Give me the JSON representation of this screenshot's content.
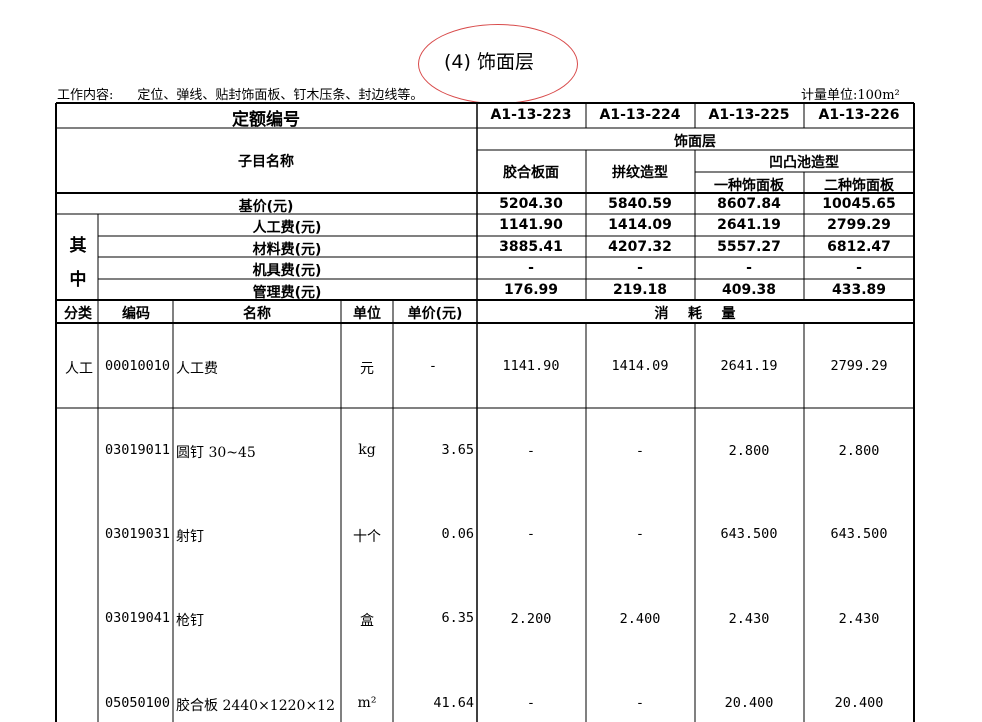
{
  "title": "(4) 饰面层",
  "work_content": {
    "label": "工作内容:",
    "text": "定位、弹线、贴封饰面板、钉木压条、封边线等。"
  },
  "measure_unit": "计量单位:100m²",
  "header": {
    "quota_label": "定额编号",
    "codes": [
      "A1-13-223",
      "A1-13-224",
      "A1-13-225",
      "A1-13-226"
    ],
    "subitem_label": "子目名称",
    "group": "饰面层",
    "col1": "胶合板面",
    "col2": "拼纹造型",
    "group2": "凹凸池造型",
    "col3": "一种饰面板",
    "col4": "二种饰面板"
  },
  "costs": {
    "base_label": "基价(元)",
    "base": [
      "5204.30",
      "5840.59",
      "8607.84",
      "10045.65"
    ],
    "among_1": "其",
    "among_2": "中",
    "labor_label": "人工费(元)",
    "labor": [
      "1141.90",
      "1414.09",
      "2641.19",
      "2799.29"
    ],
    "material_label": "材料费(元)",
    "material": [
      "3885.41",
      "4207.32",
      "5557.27",
      "6812.47"
    ],
    "machine_label": "机具费(元)",
    "machine": [
      "-",
      "-",
      "-",
      "-"
    ],
    "mgmt_label": "管理费(元)",
    "mgmt": [
      "176.99",
      "219.18",
      "409.38",
      "433.89"
    ]
  },
  "columns": {
    "category": "分类",
    "code": "编码",
    "name": "名称",
    "unit": "单位",
    "price": "单价(元)",
    "consumption": "消    耗    量"
  },
  "rows": [
    {
      "category": "人工",
      "code": "00010010",
      "name": "人工费",
      "unit": "元",
      "price": "-",
      "v": [
        "1141.90",
        "1414.09",
        "2641.19",
        "2799.29"
      ]
    },
    {
      "category": "",
      "code": "03019011",
      "name": "圆钉 30~45",
      "unit": "kg",
      "price": "3.65",
      "v": [
        "-",
        "-",
        "2.800",
        "2.800"
      ]
    },
    {
      "category": "",
      "code": "03019031",
      "name": "射钉",
      "unit": "十个",
      "price": "0.06",
      "v": [
        "-",
        "-",
        "643.500",
        "643.500"
      ]
    },
    {
      "category": "",
      "code": "03019041",
      "name": "枪钉",
      "unit": "盒",
      "price": "6.35",
      "v": [
        "2.200",
        "2.400",
        "2.430",
        "2.430"
      ]
    },
    {
      "category": "",
      "code": "05050100",
      "name": "胶合板 2440×1220×12",
      "unit": "m²",
      "price": "41.64",
      "v": [
        "-",
        "-",
        "20.400",
        "20.400"
      ]
    }
  ]
}
